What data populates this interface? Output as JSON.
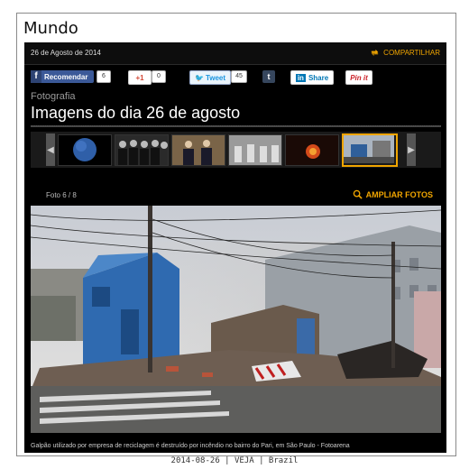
{
  "page": {
    "section_title": "Mundo"
  },
  "article": {
    "date": "26 de Agosto de 2014",
    "share_label": "COMPARTILHAR",
    "category": "Fotografia",
    "title": "Imagens do dia 26 de agosto",
    "photo_counter": "Foto 6 / 8",
    "zoom_label": "AMPLIAR FOTOS",
    "caption": "Galpão utilizado por empresa de reciclagem é  destruído por incêndio no bairro do Pari, em São Paulo - Fotoarena"
  },
  "social": {
    "facebook_label": "Recomendar",
    "facebook_count": "6",
    "gplus_label": "+1",
    "gplus_count": "0",
    "twitter_label": "Tweet",
    "twitter_count": "45",
    "tumblr_label": "t",
    "linkedin_label": "Share",
    "linkedin_badge": "in",
    "pinterest_label": "Pin it"
  },
  "thumbnails": [
    {
      "name": "thumb-planet",
      "color": "#1e3a6e"
    },
    {
      "name": "thumb-crowd",
      "color": "#5a5a5a"
    },
    {
      "name": "thumb-officials",
      "color": "#6a5a44"
    },
    {
      "name": "thumb-workers",
      "color": "#8a8a8a"
    },
    {
      "name": "thumb-fire",
      "color": "#3a1a10"
    },
    {
      "name": "thumb-building",
      "color": "#4a6a8a",
      "selected": true
    }
  ],
  "footer": "2014-08-26 | VEJA | Brazil"
}
